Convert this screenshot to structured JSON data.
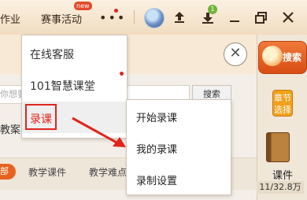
{
  "topbar": {
    "nav": [
      "作业",
      "赛事活动"
    ],
    "new_badge": "new",
    "more_icon": "more-dots-icon",
    "download_count": "1"
  },
  "main": {
    "search_placeholder": "你想要",
    "search_button": "搜索",
    "left_label": "教案",
    "tabs": [
      "部",
      "教学课件",
      "教学难点"
    ]
  },
  "sidebar": {
    "search_label": "搜索",
    "chapter_label": [
      "章节",
      "选择"
    ],
    "course_label": "课件",
    "course_count": "11/32.8万"
  },
  "dropdown": {
    "items": [
      {
        "label": "在线客服"
      },
      {
        "label": "101智慧课堂"
      },
      {
        "label": "录课"
      }
    ]
  },
  "submenu": {
    "items": [
      {
        "label": "开始录课"
      },
      {
        "label": "我的录课"
      },
      {
        "label": "录制设置"
      }
    ]
  },
  "colors": {
    "accent_orange": "#e8621f",
    "highlight_red": "#e0251e",
    "badge_green": "#6fb33a"
  }
}
